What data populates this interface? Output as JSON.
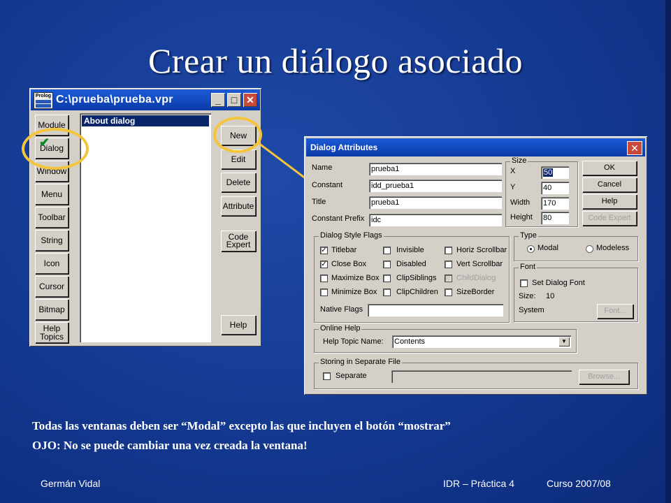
{
  "slide": {
    "title": "Crear un diálogo asociado",
    "note_line1": "Todas las ventanas deben ser “Modal” excepto las que incluyen el botón “mostrar”",
    "note_line2": "OJO: No se puede cambiar una vez creada la ventana!",
    "footer_author": "Germán Vidal",
    "footer_course": "IDR – Práctica 4",
    "footer_year": "Curso 2007/08",
    "accent_color": "#f4c53a"
  },
  "vpr_window": {
    "logo_text": "Prolog",
    "title": "C:\\prueba\\prueba.vpr",
    "minimize": "_",
    "maximize": "□",
    "close": "✕",
    "left_buttons": [
      "Module",
      "Dialog",
      "Window",
      "Menu",
      "Toolbar",
      "String",
      "Icon",
      "Cursor",
      "Bitmap",
      "Help Topics"
    ],
    "list_items": [
      "About dialog"
    ],
    "right_buttons": {
      "new": "New",
      "edit": "Edit",
      "delete": "Delete",
      "attribute": "Attribute",
      "code_expert": "Code Expert",
      "help": "Help"
    }
  },
  "dialog": {
    "title": "Dialog Attributes",
    "close": "✕",
    "name_label": "Name",
    "name_value": "prueba1",
    "constant_label": "Constant",
    "constant_value": "idd_prueba1",
    "title_label": "Title",
    "title_value": "prueba1",
    "prefix_label": "Constant Prefix",
    "prefix_value": "idc",
    "size_group": "Size",
    "x_label": "X",
    "x_value": "50",
    "y_label": "Y",
    "y_value": "40",
    "width_label": "Width",
    "width_value": "170",
    "height_label": "Height",
    "height_value": "80",
    "ok": "OK",
    "cancel": "Cancel",
    "help": "Help",
    "code_expert": "Code Expert",
    "style_group": "Dialog Style Flags",
    "flags": {
      "titlebar": {
        "label": "Titlebar",
        "checked": true
      },
      "invisible": {
        "label": "Invisible",
        "checked": false
      },
      "horiz_scrollbar": {
        "label": "Horiz Scrollbar",
        "checked": false
      },
      "close_box": {
        "label": "Close Box",
        "checked": true
      },
      "disabled": {
        "label": "Disabled",
        "checked": false
      },
      "vert_scrollbar": {
        "label": "Vert Scrollbar",
        "checked": false
      },
      "maximize_box": {
        "label": "Maximize Box",
        "checked": false
      },
      "clip_siblings": {
        "label": "ClipSiblings",
        "checked": false
      },
      "child_dialog": {
        "label": "ChildDialog",
        "checked": false
      },
      "minimize_box": {
        "label": "Minimize Box",
        "checked": false
      },
      "clip_children": {
        "label": "ClipChildren",
        "checked": false
      },
      "size_border": {
        "label": "SizeBorder",
        "checked": false
      }
    },
    "native_flags_label": "Native Flags",
    "native_flags_value": "",
    "type_group": "Type",
    "modal_label": "Modal",
    "modeless_label": "Modeless",
    "font_group": "Font",
    "set_font_label": "Set Dialog Font",
    "font_size_label": "Size:",
    "font_size_value": "10",
    "font_name": "System",
    "font_button": "Font...",
    "online_help_group": "Online Help",
    "help_topic_label": "Help Topic Name:",
    "help_topic_value": "Contents",
    "storing_group": "Storing in Separate File",
    "separate_label": "Separate",
    "separate_value": "",
    "browse": "Browse..."
  }
}
